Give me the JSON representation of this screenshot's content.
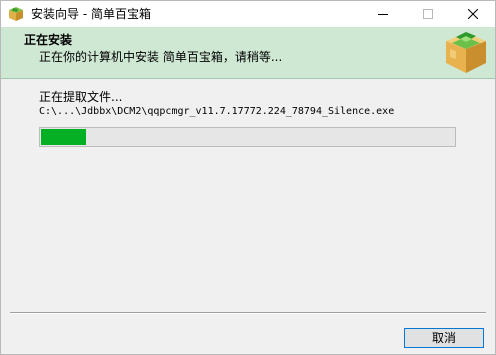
{
  "window": {
    "title": "安装向导 - 简单百宝箱",
    "icon": "box-logo-icon",
    "controls": [
      "minimize-icon",
      "maximize-icon",
      "close-icon"
    ]
  },
  "header": {
    "title": "正在安装",
    "subtitle": "正在你的计算机中安装 简单百宝箱，请稍等...",
    "logo": "package-box-logo"
  },
  "main": {
    "status_label": "正在提取文件...",
    "file_path": "C:\\...\\Jdbbx\\DCM2\\qqpcmgr_v11.7.17772.224_78794_Silence.exe",
    "progress_fraction": 0.11,
    "progress_color": "#06b025"
  },
  "footer": {
    "cancel_label": "取消"
  },
  "colors": {
    "header_bg": "#cfe8d4",
    "accent": "#0078d7"
  }
}
